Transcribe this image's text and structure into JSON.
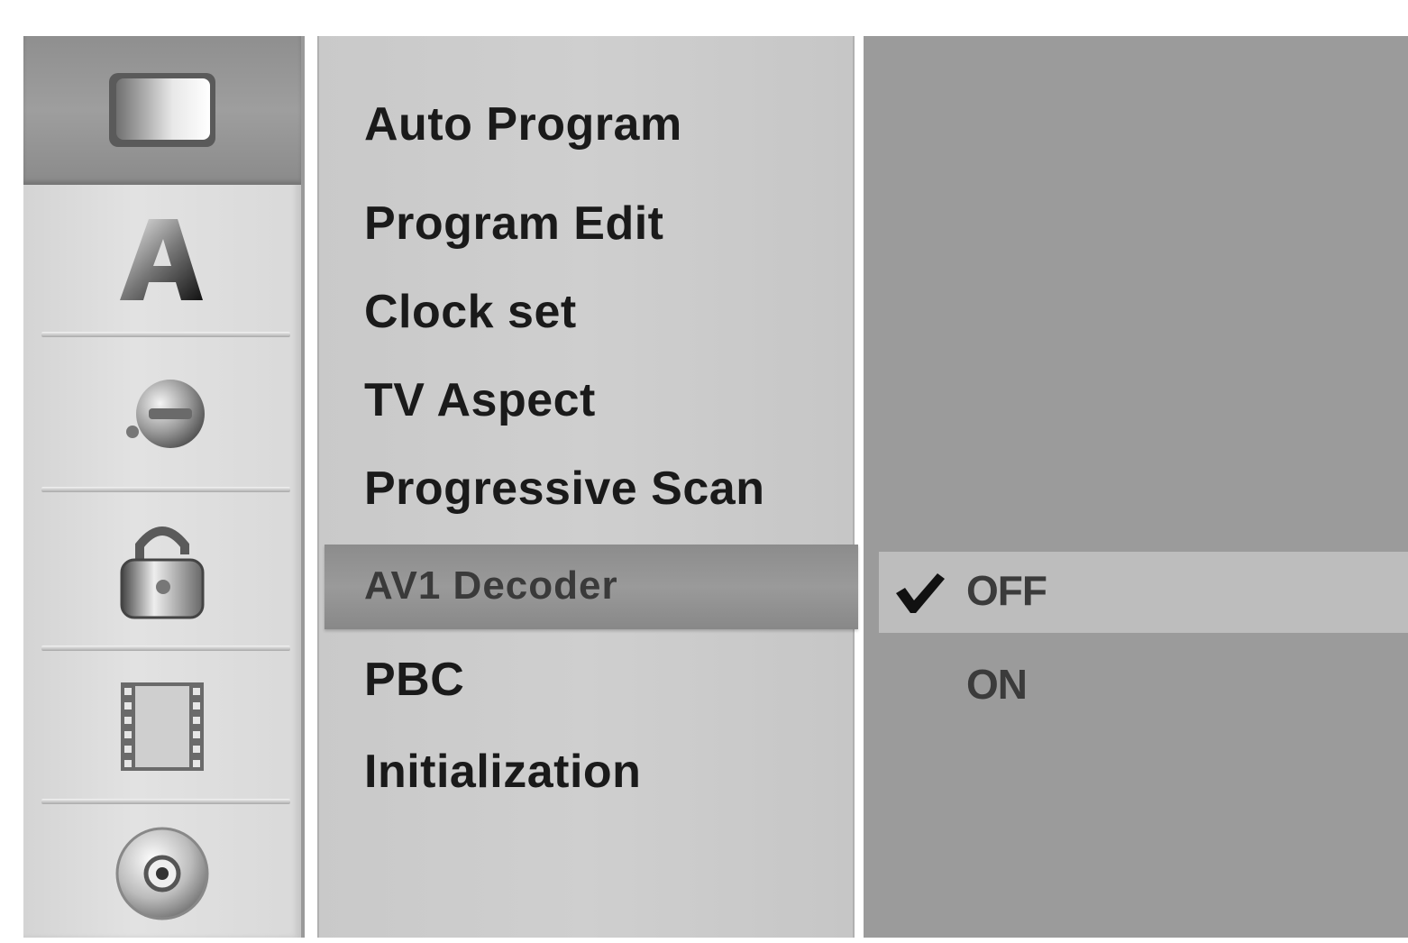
{
  "sidebar": {
    "icons": [
      {
        "name": "tv-setup-icon",
        "selected": true
      },
      {
        "name": "language-icon",
        "selected": false
      },
      {
        "name": "audio-icon",
        "selected": false
      },
      {
        "name": "lock-icon",
        "selected": false
      },
      {
        "name": "recording-icon",
        "selected": false
      },
      {
        "name": "disc-icon",
        "selected": false
      }
    ]
  },
  "menu": {
    "items": [
      {
        "label": "Auto Program"
      },
      {
        "label": "Program Edit"
      },
      {
        "label": "Clock set"
      },
      {
        "label": "TV Aspect"
      },
      {
        "label": "Progressive Scan"
      },
      {
        "label": "AV1 Decoder",
        "selected": true
      },
      {
        "label": "PBC"
      },
      {
        "label": "Initialization"
      }
    ]
  },
  "submenu": {
    "options": [
      {
        "label": "OFF",
        "checked": true
      },
      {
        "label": "ON",
        "checked": false
      }
    ]
  },
  "colors": {
    "highlight": "#9a9a9a",
    "panel": "#9b9b9b",
    "text": "#1a1a1a"
  }
}
